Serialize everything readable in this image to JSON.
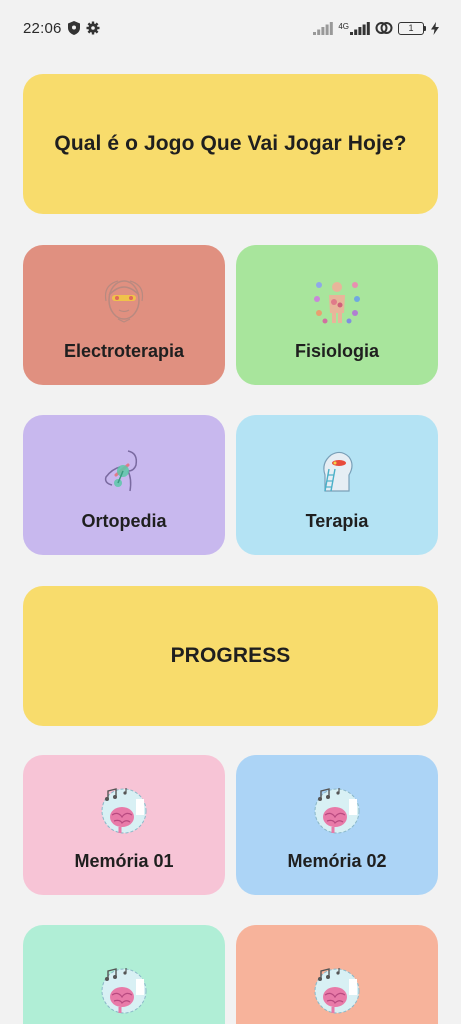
{
  "status": {
    "time": "22:06",
    "network": "4G",
    "battery": "1"
  },
  "header": {
    "title": "Qual é o Jogo Que Vai Jogar Hoje?"
  },
  "games": [
    {
      "label": "Electroterapia",
      "icon": "electrotherapy-face-icon",
      "color": "#e09080"
    },
    {
      "label": "Fisiologia",
      "icon": "physiology-body-icon",
      "color": "#a8e59c"
    },
    {
      "label": "Ortopedia",
      "icon": "orthopedics-neck-icon",
      "color": "#c8b8ee"
    },
    {
      "label": "Terapia",
      "icon": "therapy-head-ladder-icon",
      "color": "#b4e3f4"
    }
  ],
  "progress": {
    "title": "PROGRESS"
  },
  "memory": [
    {
      "label": "Memória 01",
      "icon": "memory-brain-music-icon",
      "color": "#f7c4d6"
    },
    {
      "label": "Memória 02",
      "icon": "memory-brain-music-icon",
      "color": "#acd4f6"
    },
    {
      "label": "",
      "icon": "memory-brain-music-icon",
      "color": "#b0eed6"
    },
    {
      "label": "",
      "icon": "memory-brain-music-icon",
      "color": "#f7b39b"
    }
  ]
}
